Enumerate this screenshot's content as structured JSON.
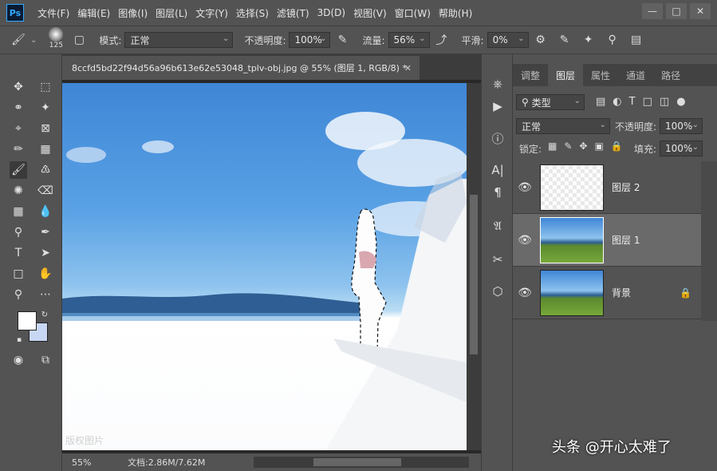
{
  "app": {
    "logo": "Ps",
    "menu": [
      "文件(F)",
      "编辑(E)",
      "图像(I)",
      "图层(L)",
      "文字(Y)",
      "选择(S)",
      "滤镜(T)",
      "3D(D)",
      "视图(V)",
      "窗口(W)",
      "帮助(H)"
    ]
  },
  "options": {
    "brush_size": "125",
    "mode_label": "模式:",
    "mode_value": "正常",
    "opacity_label": "不透明度:",
    "opacity_value": "100%",
    "flow_label": "流量:",
    "flow_value": "56%",
    "smooth_label": "平滑:",
    "smooth_value": "0%"
  },
  "document": {
    "tab_title": "8ccfd5bd22f94d56a96b613e62e53048_tplv-obj.jpg @ 55% (图层 1, RGB/8) *",
    "zoom": "55%",
    "doc_size": "文档:2.86M/7.62M",
    "canvas_watermark": "版权图片"
  },
  "panel": {
    "tabs": [
      "调整",
      "图层",
      "属性",
      "通道",
      "路径"
    ],
    "filter_label": "类型",
    "blend_mode": "正常",
    "opacity_label": "不透明度:",
    "opacity_value": "100%",
    "lock_label": "锁定:",
    "fill_label": "填充:",
    "fill_value": "100%",
    "layers": [
      {
        "name": "图层 2"
      },
      {
        "name": "图层 1"
      },
      {
        "name": "背景"
      }
    ]
  },
  "overlay": {
    "watermark": "头条 @开心太难了"
  },
  "colors": {
    "foreground": "#ffffff",
    "background": "#c8d8f4",
    "accent": "#31a8ff"
  }
}
